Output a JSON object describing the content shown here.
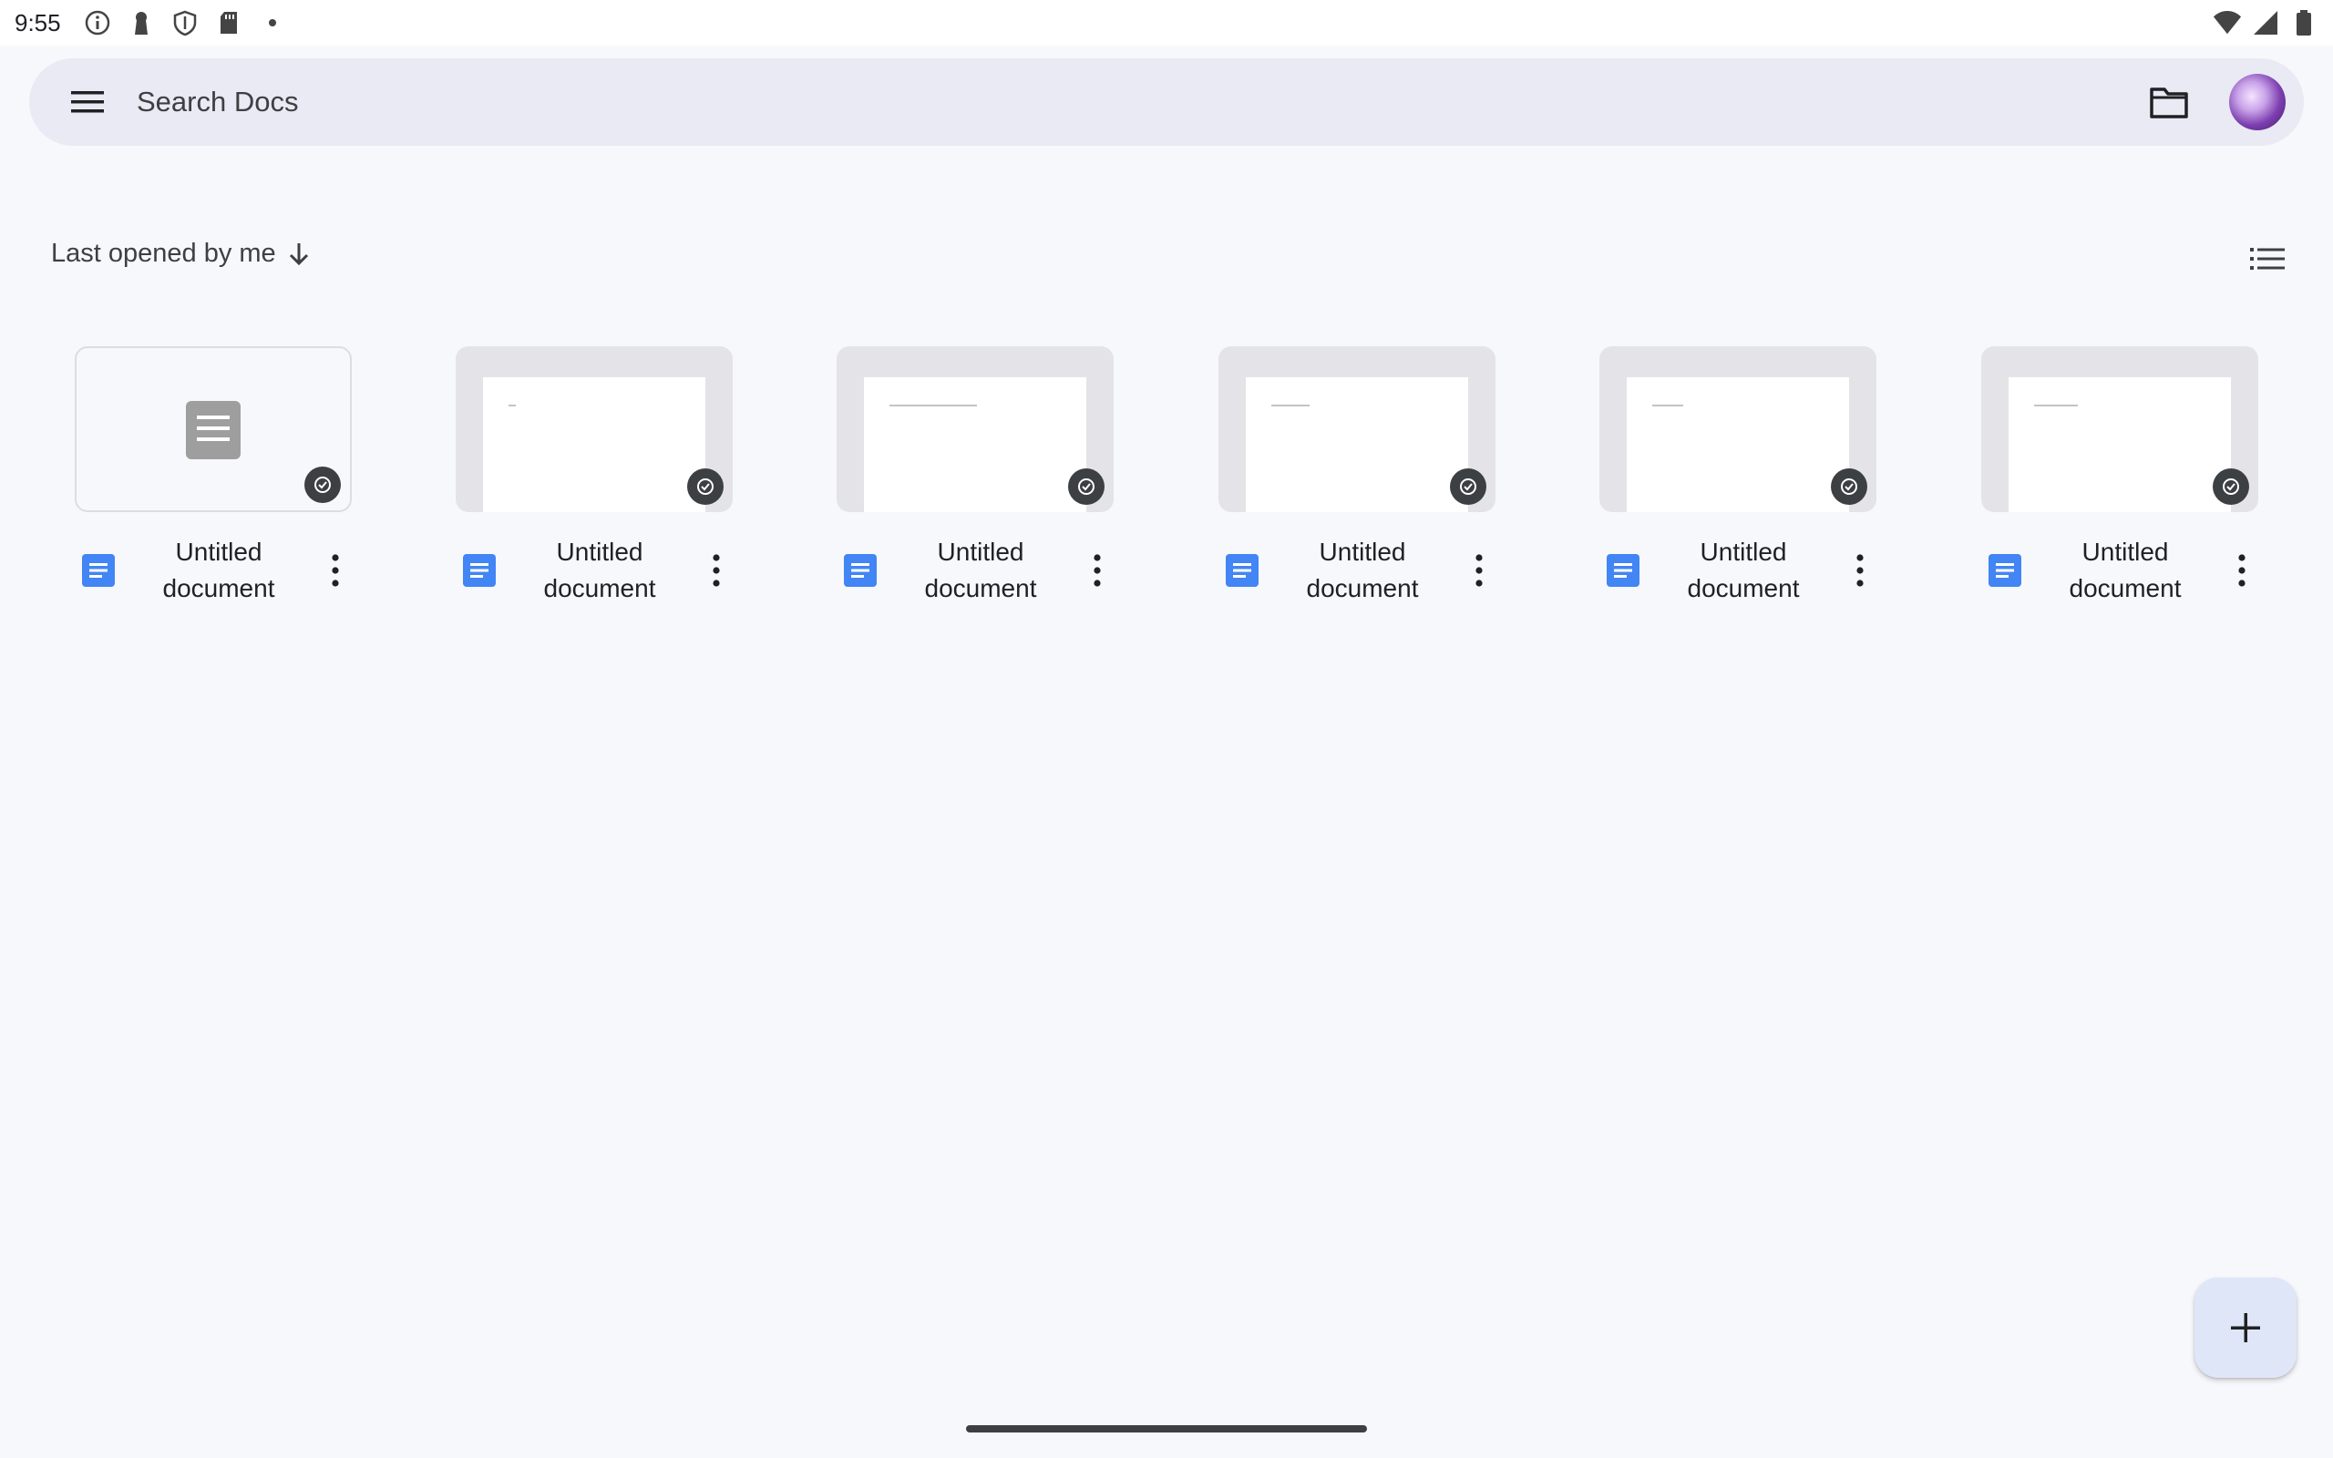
{
  "status_bar": {
    "time": "9:55",
    "icons": [
      "info-icon",
      "keyhole-icon",
      "shield-icon",
      "sd-card-icon",
      "dot-icon"
    ],
    "right_icons": [
      "wifi-icon",
      "signal-icon",
      "battery-icon"
    ]
  },
  "search": {
    "placeholder": "Search Docs",
    "menu_icon": "hamburger-menu-icon",
    "folder_icon": "folder-icon",
    "avatar": "account-avatar"
  },
  "sort": {
    "label": "Last opened by me",
    "direction_icon": "arrow-down-icon",
    "view_toggle_icon": "list-view-icon"
  },
  "documents": [
    {
      "title": "Untitled document",
      "thumbnail": "blank"
    },
    {
      "title": "Untitled document",
      "thumbnail": "page"
    },
    {
      "title": "Untitled document",
      "thumbnail": "page"
    },
    {
      "title": "Untitled document",
      "thumbnail": "page"
    },
    {
      "title": "Untitled document",
      "thumbnail": "page"
    },
    {
      "title": "Untitled document",
      "thumbnail": "page"
    }
  ],
  "fab": {
    "icon": "plus-icon"
  },
  "colors": {
    "background": "#f7f8fc",
    "search_bar": "#e9eaf3",
    "docs_blue": "#4285f4",
    "badge": "#3c4043",
    "fab": "#dfe6f8"
  }
}
